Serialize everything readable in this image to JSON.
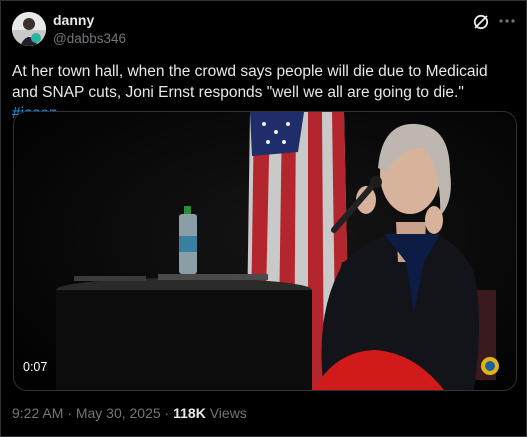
{
  "author": {
    "display_name": "danny",
    "handle": "@dabbs346"
  },
  "tweet": {
    "text": "At her town hall, when the crowd says people will die due to Medicaid and SNAP cuts, Joni Ernst responds \"well we all are going to die.\" ",
    "hashtag": "#iasen"
  },
  "video": {
    "duration": "0:07"
  },
  "footer": {
    "time": "9:22 AM",
    "sep1": " · ",
    "date": "May 30, 2025",
    "sep2": " · ",
    "views_count": "118K",
    "views_label": " Views"
  },
  "icons": {
    "grok": "grok-icon",
    "more": "more-options-icon"
  }
}
